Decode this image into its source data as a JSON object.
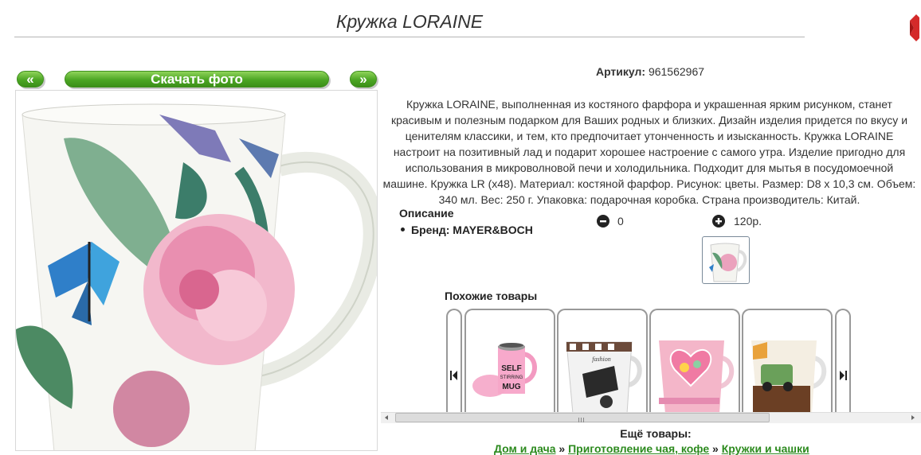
{
  "header": {
    "title": "Кружка LORAINE"
  },
  "gallery": {
    "prev_label": "«",
    "download_label": "Скачать фото",
    "next_label": "»"
  },
  "product": {
    "sku_label": "Артикул:",
    "sku_value": "961562967",
    "description": "Кружка LORAINE, выполненная из костяного фарфора и украшенная ярким рисунком, станет красивым и полезным подарком для Ваших родных и близких. Дизайн изделия придется по вкусу и ценителям классики, и тем, кто предпочитает утонченность и изысканность. Кружка LORAINE настроит на позитивный лад и подарит хорошее настроение с самого утра. Изделие пригодно для использования в микроволновой печи и холодильника. Подходит для мытья в посудомоечной машине. Кружка LR (х48). Материал: костяной фарфор. Рисунок: цветы. Размер: D8 x 10,3 см. Объем: 340 мл. Вес: 250 г. Упаковка: подарочная коробка. Страна производитель: Китай.",
    "section_label": "Описание",
    "brand_text": "Бренд: MAYER&BOCH",
    "quantity": "0",
    "price": "120р."
  },
  "similar": {
    "title": "Похожие товары",
    "items": [
      {
        "mug_text_1": "SELF",
        "mug_text_2": "STIRRING",
        "mug_text_3": "MUG"
      },
      {
        "mug_text": "fashion"
      },
      {
        "mug_text": ""
      },
      {
        "mug_text": ""
      }
    ]
  },
  "more": {
    "title": "Ещё товары:"
  },
  "breadcrumb": {
    "items": [
      "Дом и дача",
      "Приготовление чая, кофе",
      "Кружки и чашки"
    ],
    "separator": "»"
  },
  "colors": {
    "green_button": "#4ca624",
    "link_green": "#2c8a1e",
    "close_red": "#d42a2a"
  }
}
